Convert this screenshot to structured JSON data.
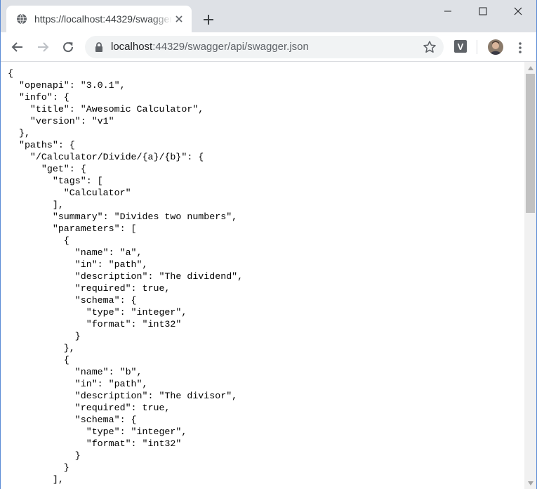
{
  "tab": {
    "title": "https://localhost:44329/swagger/api/swagger.json",
    "favicon_icon": "globe-icon",
    "close_icon": "close-icon"
  },
  "window_controls": [
    "minimize-icon",
    "maximize-icon",
    "close-icon"
  ],
  "toolbar": {
    "url_host": "localhost",
    "url_rest": ":44329/swagger/api/swagger.json",
    "extension_label": "V"
  },
  "colors": {
    "tabstrip": "#dee1e6",
    "omnibox": "#f1f3f4",
    "accent_border": "#5b8bd6",
    "scroll_thumb": "#c1c1c1"
  },
  "json_lines": [
    "{",
    "  \"openapi\": \"3.0.1\",",
    "  \"info\": {",
    "    \"title\": \"Awesomic Calculator\",",
    "    \"version\": \"v1\"",
    "  },",
    "  \"paths\": {",
    "    \"/Calculator/Divide/{a}/{b}\": {",
    "      \"get\": {",
    "        \"tags\": [",
    "          \"Calculator\"",
    "        ],",
    "        \"summary\": \"Divides two numbers\",",
    "        \"parameters\": [",
    "          {",
    "            \"name\": \"a\",",
    "            \"in\": \"path\",",
    "            \"description\": \"The dividend\",",
    "            \"required\": true,",
    "            \"schema\": {",
    "              \"type\": \"integer\",",
    "              \"format\": \"int32\"",
    "            }",
    "          },",
    "          {",
    "            \"name\": \"b\",",
    "            \"in\": \"path\",",
    "            \"description\": \"The divisor\",",
    "            \"required\": true,",
    "            \"schema\": {",
    "              \"type\": \"integer\",",
    "              \"format\": \"int32\"",
    "            }",
    "          }",
    "        ],"
  ]
}
